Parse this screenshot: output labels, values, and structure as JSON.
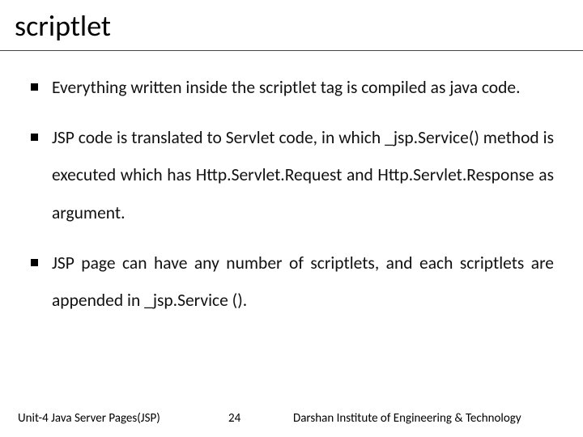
{
  "title": "scriptlet",
  "bullets": [
    "Everything written inside the scriptlet tag is compiled as java code.",
    "JSP code is translated to Servlet code, in which _jsp.Service() method is executed which has Http.Servlet.Request and Http.Servlet.Response as argument.",
    "JSP page can have any number of scriptlets, and each scriptlets are appended in _jsp.Service ()."
  ],
  "footer": {
    "left": "Unit-4 Java Server Pages(JSP)",
    "page": "24",
    "right": "Darshan Institute of Engineering & Technology"
  }
}
